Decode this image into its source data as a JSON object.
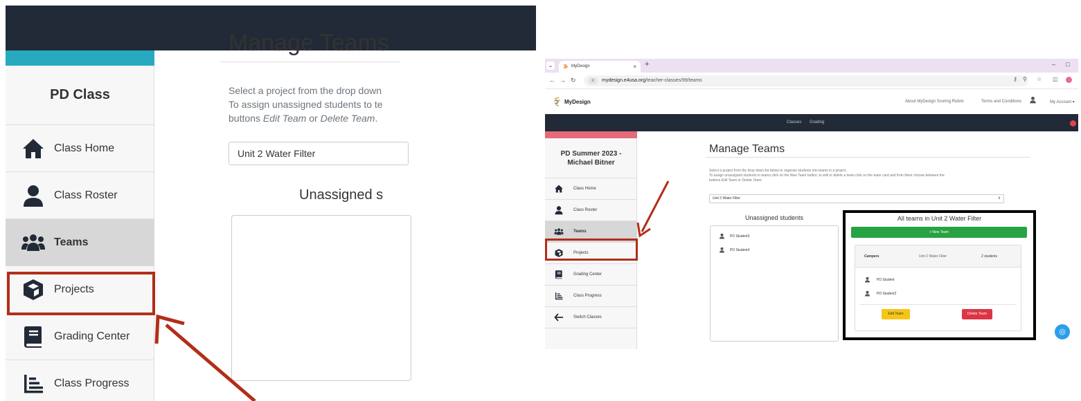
{
  "colors": {
    "dark_nav": "#212a36",
    "teal_accent": "#27aabf",
    "pink_accent": "#e56a7a",
    "highlight_red": "#b22e1a",
    "success_green": "#27a344",
    "warning_yellow": "#f5c518",
    "danger_red": "#dc3545"
  },
  "zoomed": {
    "sidebar": {
      "title": "PD Class",
      "items": [
        {
          "label": "Class Home",
          "icon": "home-icon"
        },
        {
          "label": "Class Roster",
          "icon": "person-icon"
        },
        {
          "label": "Teams",
          "icon": "users-icon",
          "active": true
        },
        {
          "label": "Projects",
          "icon": "cube-icon"
        },
        {
          "label": "Grading Center",
          "icon": "book-icon"
        },
        {
          "label": "Class Progress",
          "icon": "progress-icon"
        }
      ]
    },
    "main": {
      "title": "Manage Teams",
      "desc_line1": "Select a project from the drop down",
      "desc_line2": "To assign unassigned students to te",
      "desc_line3_prefix": "buttons ",
      "desc_line3_edit": "Edit Team",
      "desc_line3_or": " or ",
      "desc_line3_delete": "Delete Team",
      "desc_line3_end": ".",
      "select_value": "Unit 2 Water Filter",
      "unassigned_heading": "Unassigned s"
    }
  },
  "browser": {
    "tab_title": "MyDesign",
    "url_domain": "mydesign.e4usa.org",
    "url_path": "/teacher-classes/99/teams",
    "brand": "MyDesign",
    "top_links": [
      "About MyDesign Scoring Rubric",
      "Terms and Conditions",
      "My Account ▾"
    ],
    "nav_links": [
      "Classes",
      "Grading"
    ]
  },
  "app": {
    "sidebar": {
      "title": "PD Summer 2023 - Michael Bitner",
      "items": [
        {
          "label": "Class Home",
          "icon": "home-icon"
        },
        {
          "label": "Class Roster",
          "icon": "person-icon"
        },
        {
          "label": "Teams",
          "icon": "users-icon",
          "active": true
        },
        {
          "label": "Projects",
          "icon": "cube-icon"
        },
        {
          "label": "Grading Center",
          "icon": "book-icon"
        },
        {
          "label": "Class Progress",
          "icon": "progress-icon"
        },
        {
          "label": "Switch Classes",
          "icon": "arrow-left-icon"
        }
      ]
    },
    "main": {
      "title": "Manage Teams",
      "desc_line1": "Select a project from the drop down list below to organize students into teams in a project.",
      "desc_line2_a": "To assign unassigned students to teams click on the ",
      "desc_line2_new": "New Team",
      "desc_line2_b": " button, to edit or delete a team click on the team card and from there choose between the",
      "desc_line3_prefix": "buttons ",
      "desc_line3_edit": "Edit Team",
      "desc_line3_or": " or ",
      "desc_line3_delete": "Delete Team",
      "desc_line3_end": ".",
      "select_value": "Unit 2 Water Filter",
      "unassigned_heading": "Unassigned students",
      "unassigned_students": [
        "PD Student3",
        "PD Student4"
      ],
      "teams_heading": "All teams in Unit 2 Water Filter",
      "new_team_label": "+ New Team",
      "team": {
        "name": "Campers",
        "project": "Unit 2 Water Filter",
        "count": "2 students",
        "members": [
          "PD Student",
          "PD Student2"
        ],
        "edit_label": "Edit Team",
        "delete_label": "Delete Team"
      }
    }
  }
}
